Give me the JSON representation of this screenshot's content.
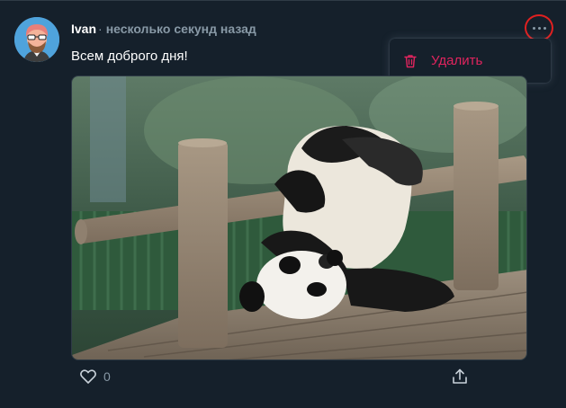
{
  "post": {
    "author": "Ivan",
    "separator": "·",
    "time": "несколько секунд назад",
    "text": "Всем доброго дня!",
    "likes": "0"
  },
  "menu": {
    "delete_label": "Удалить"
  },
  "icons": {
    "more": "more-dots-icon",
    "delete": "trash-icon",
    "like": "heart-icon",
    "share": "share-icon"
  },
  "colors": {
    "background": "#15202b",
    "secondary_text": "#8899a6",
    "danger": "#e0245e",
    "highlight_ring": "#e02020"
  }
}
